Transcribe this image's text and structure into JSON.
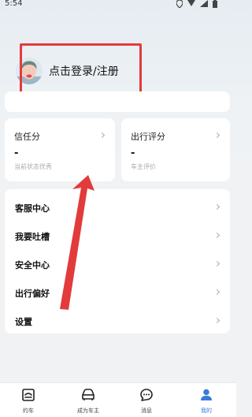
{
  "status_bar": {
    "time": "5:54"
  },
  "profile": {
    "login_text": "点击登录/注册"
  },
  "cards": [
    {
      "title": "信任分",
      "value": "-",
      "subtitle": "当前状态优秀"
    },
    {
      "title": "出行评分",
      "value": "-",
      "subtitle": "车主评价"
    }
  ],
  "menu": {
    "items": [
      {
        "label": "客服中心"
      },
      {
        "label": "我要吐槽"
      },
      {
        "label": "安全中心"
      },
      {
        "label": "出行偏好"
      },
      {
        "label": "设置"
      }
    ]
  },
  "tabbar": {
    "items": [
      {
        "label": "约车",
        "icon": "car-ride-icon"
      },
      {
        "label": "成为车主",
        "icon": "car-icon"
      },
      {
        "label": "消息",
        "icon": "message-icon"
      },
      {
        "label": "我的",
        "icon": "user-icon",
        "active": true
      }
    ]
  },
  "colors": {
    "accent": "#3b7bd8",
    "annotation": "#e23b3b"
  }
}
